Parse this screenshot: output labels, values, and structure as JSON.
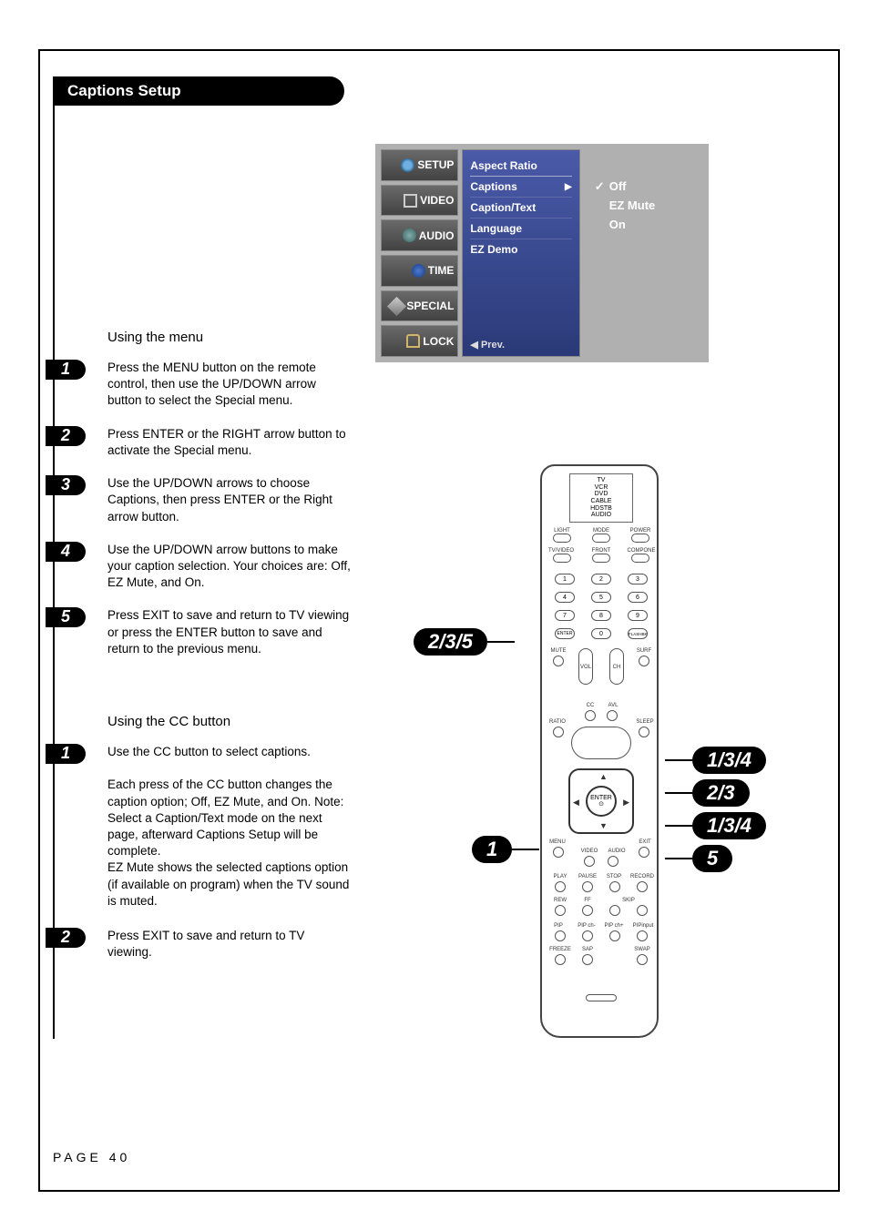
{
  "title": "Captions Setup",
  "footer": "PAGE 40",
  "osd": {
    "tabs": [
      "SETUP",
      "VIDEO",
      "AUDIO",
      "TIME",
      "SPECIAL",
      "LOCK"
    ],
    "menu_items": [
      "Aspect Ratio",
      "Captions",
      "Caption/Text",
      "Language",
      "EZ Demo"
    ],
    "selected_index": 1,
    "prev": "◀ Prev.",
    "options": [
      "Off",
      "EZ Mute",
      "On"
    ],
    "option_selected": 0
  },
  "section1": {
    "heading": "Using the menu",
    "steps": [
      "Press the MENU button on the remote control, then use the UP/DOWN arrow button to select the Special menu.",
      "Press ENTER or the RIGHT arrow button to activate the Special menu.",
      "Use the UP/DOWN arrows to choose Captions, then press ENTER or the Right arrow button.",
      "Use the UP/DOWN arrow buttons to make your caption selection. Your choices are: Off, EZ Mute, and On.",
      "Press EXIT to save and return to TV viewing or press the ENTER button to save and return to the previous menu."
    ]
  },
  "section2": {
    "heading": "Using the CC button",
    "steps": [
      "Use the CC button to select captions.",
      "Press EXIT to save and return to TV viewing."
    ],
    "note": "Each press of the CC button changes the caption option; Off, EZ Mute, and On. Note: Select a Caption/Text mode on the next page, afterward Captions Setup will be complete.\nEZ Mute shows the selected captions option (if available on program) when the TV sound is muted."
  },
  "remote": {
    "screen_lines": [
      "TV",
      "VCR",
      "DVD",
      "CABLE",
      "HDSTB",
      "AUDIO"
    ],
    "row_top": {
      "left": "LIGHT",
      "mid": "MODE",
      "right": "POWER",
      "right_prefix": "⏻"
    },
    "row_front": {
      "left": "TV/VIDEO",
      "mid": "FRONT",
      "right": "COMPONE"
    },
    "numpad": [
      [
        "1",
        "2",
        "3"
      ],
      [
        "4",
        "5",
        "6"
      ],
      [
        "7",
        "8",
        "9"
      ],
      [
        "ENTER",
        "0",
        "FLASHBK"
      ]
    ],
    "mute": "MUTE",
    "surf": "SURF",
    "vol": "VOL",
    "ch": "CH",
    "cc": "CC",
    "avl": "AVL",
    "ratio": "RATIO",
    "sleep": "SLEEP",
    "enter": "ENTER",
    "menu": "MENU",
    "exit": "EXIT",
    "video": "VIDEO",
    "audio": "AUDIO",
    "play": "PLAY",
    "pause": "PAUSE",
    "stop": "STOP",
    "record": "RECORD",
    "rew": "REW",
    "ff": "FF",
    "skip": "SKIP",
    "pip": "PIP",
    "pipchm": "PIP ch-",
    "pipchp": "PIP ch+",
    "pipinput": "PIPinput",
    "freeze": "FREEZE",
    "sap": "SAP",
    "swap": "SWAP"
  },
  "callouts": {
    "c235": "2/3/5",
    "c1": "1",
    "r134a": "1/3/4",
    "r23": "2/3",
    "r134b": "1/3/4",
    "r5": "5"
  }
}
